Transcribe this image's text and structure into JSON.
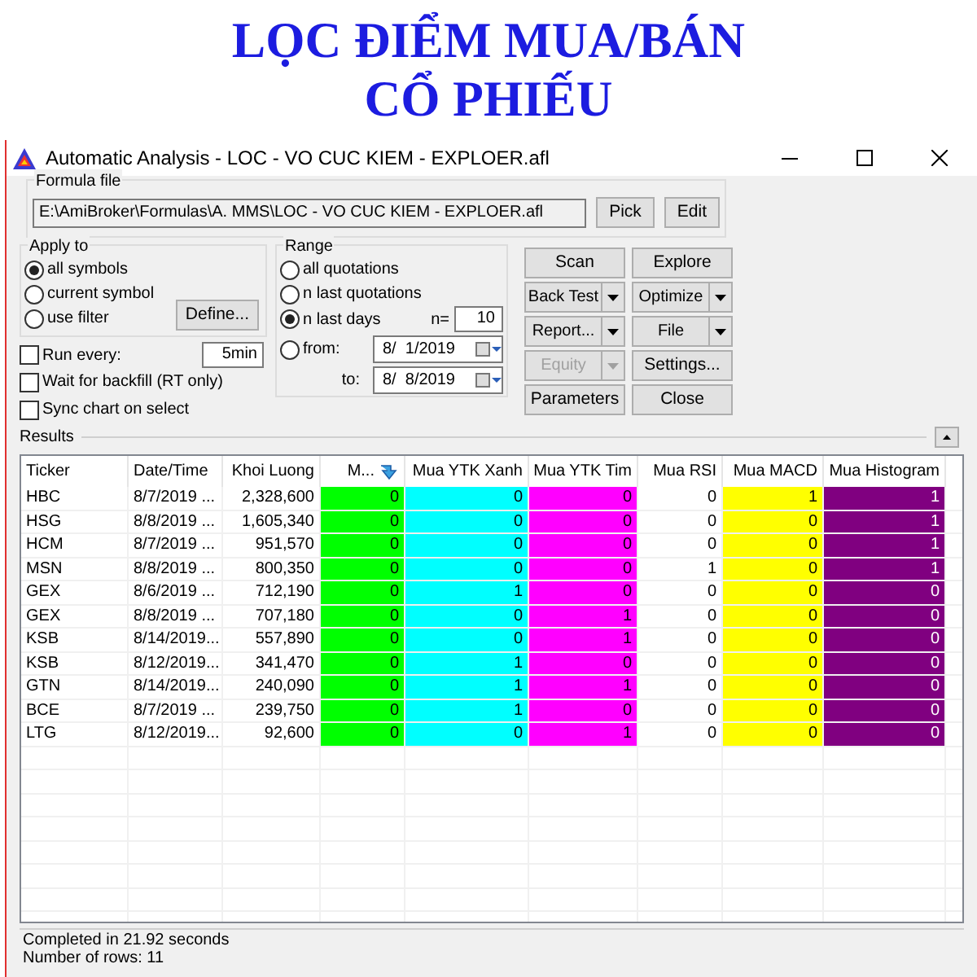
{
  "page_heading": [
    "LỌC ĐIỂM MUA/BÁN",
    "CỔ PHIẾU"
  ],
  "window": {
    "title": "Automatic Analysis - LOC - VO CUC KIEM - EXPLOER.afl"
  },
  "formula_file": {
    "label": "Formula file",
    "path": "E:\\AmiBroker\\Formulas\\A. MMS\\LOC - VO CUC KIEM - EXPLOER.afl",
    "buttons": [
      "Pick",
      "Edit"
    ]
  },
  "apply_to": {
    "label": "Apply to",
    "options": [
      {
        "label": "all symbols",
        "selected": true
      },
      {
        "label": "current symbol",
        "selected": false
      },
      {
        "label": "use filter",
        "selected": false
      }
    ],
    "define_button": "Define..."
  },
  "run_every": {
    "label": "Run every:",
    "checked": false,
    "value": "5min"
  },
  "checkboxes": [
    {
      "label": "Wait for backfill (RT only)",
      "checked": false
    },
    {
      "label": "Sync chart on select",
      "checked": false
    }
  ],
  "range": {
    "label": "Range",
    "options": [
      {
        "label": "all quotations",
        "selected": false
      },
      {
        "label": "n last quotations",
        "selected": false
      },
      {
        "label": "n last days",
        "selected": true
      },
      {
        "label": "from:",
        "selected": false
      }
    ],
    "n_label": "n=",
    "n_value": "10",
    "from_date": "8/  1/2019",
    "to_label": "to:",
    "to_date": "8/  8/2019"
  },
  "actions": [
    {
      "label": "Scan",
      "kind": "plain",
      "disabled": false
    },
    {
      "label": "Explore",
      "kind": "plain",
      "disabled": false
    },
    {
      "label": "Back Test",
      "kind": "split",
      "disabled": false
    },
    {
      "label": "Optimize",
      "kind": "split",
      "disabled": false
    },
    {
      "label": "Report...",
      "kind": "split",
      "disabled": false
    },
    {
      "label": "File",
      "kind": "split",
      "disabled": false
    },
    {
      "label": "Equity",
      "kind": "split",
      "disabled": true
    },
    {
      "label": "Settings...",
      "kind": "plain",
      "disabled": false
    },
    {
      "label": "Parameters",
      "kind": "plain",
      "disabled": false
    },
    {
      "label": "Close",
      "kind": "plain",
      "disabled": false
    }
  ],
  "results": {
    "label": "Results",
    "columns": [
      {
        "label": "Ticker",
        "kind": "text"
      },
      {
        "label": "Date/Time",
        "kind": "text"
      },
      {
        "label": "Khoi Luong",
        "kind": "number"
      },
      {
        "label": "M...",
        "kind": "number",
        "color": "#00ff00",
        "sorted": true
      },
      {
        "label": "Mua YTK Xanh",
        "kind": "number",
        "color": "#00ffff"
      },
      {
        "label": "Mua YTK Tim",
        "kind": "number",
        "color": "#ff00ff"
      },
      {
        "label": "Mua RSI",
        "kind": "number"
      },
      {
        "label": "Mua MACD",
        "kind": "number",
        "color": "#ffff00"
      },
      {
        "label": "Mua Histogram",
        "kind": "number",
        "color": "#800080"
      }
    ],
    "rows": [
      [
        "HBC",
        "8/7/2019 ...",
        "2,328,600",
        "0",
        "0",
        "0",
        "0",
        "1",
        "1"
      ],
      [
        "HSG",
        "8/8/2019 ...",
        "1,605,340",
        "0",
        "0",
        "0",
        "0",
        "0",
        "1"
      ],
      [
        "HCM",
        "8/7/2019 ...",
        "951,570",
        "0",
        "0",
        "0",
        "0",
        "0",
        "1"
      ],
      [
        "MSN",
        "8/8/2019 ...",
        "800,350",
        "0",
        "0",
        "0",
        "1",
        "0",
        "1"
      ],
      [
        "GEX",
        "8/6/2019 ...",
        "712,190",
        "0",
        "1",
        "0",
        "0",
        "0",
        "0"
      ],
      [
        "GEX",
        "8/8/2019 ...",
        "707,180",
        "0",
        "0",
        "1",
        "0",
        "0",
        "0"
      ],
      [
        "KSB",
        "8/14/2019...",
        "557,890",
        "0",
        "0",
        "1",
        "0",
        "0",
        "0"
      ],
      [
        "KSB",
        "8/12/2019...",
        "341,470",
        "0",
        "1",
        "0",
        "0",
        "0",
        "0"
      ],
      [
        "GTN",
        "8/14/2019...",
        "240,090",
        "0",
        "1",
        "1",
        "0",
        "0",
        "0"
      ],
      [
        "BCE",
        "8/7/2019 ...",
        "239,750",
        "0",
        "1",
        "0",
        "0",
        "0",
        "0"
      ],
      [
        "LTG",
        "8/12/2019...",
        "92,600",
        "0",
        "0",
        "1",
        "0",
        "0",
        "0"
      ]
    ]
  },
  "status": [
    "Completed in 21.92 seconds",
    "Number of rows: 11"
  ]
}
